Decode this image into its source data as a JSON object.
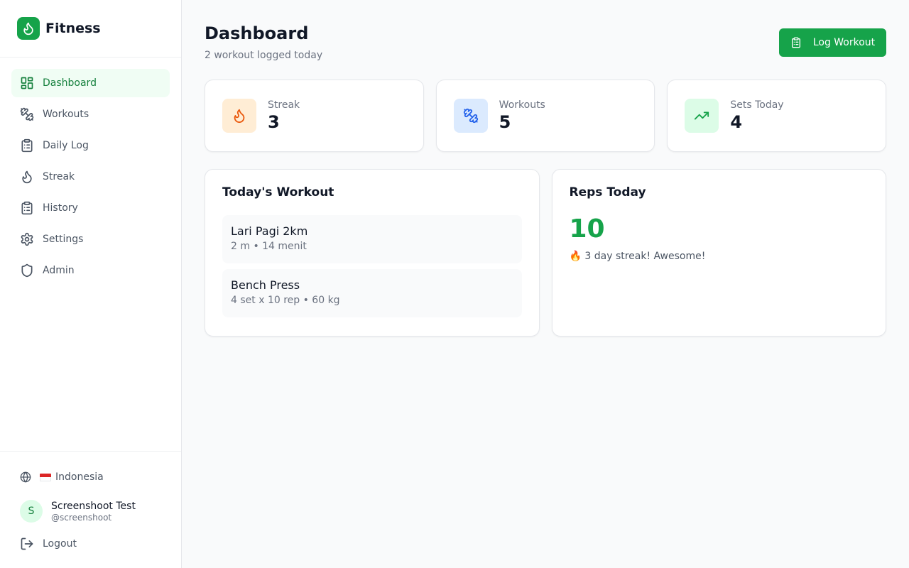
{
  "brand": {
    "name": "Fitness"
  },
  "nav": {
    "items": [
      {
        "label": "Dashboard",
        "icon": "dashboard-icon",
        "active": true
      },
      {
        "label": "Workouts",
        "icon": "dumbbell-icon"
      },
      {
        "label": "Daily Log",
        "icon": "clipboard-icon"
      },
      {
        "label": "Streak",
        "icon": "flame-icon"
      },
      {
        "label": "History",
        "icon": "clipboard-list-icon"
      },
      {
        "label": "Settings",
        "icon": "gear-icon"
      },
      {
        "label": "Admin",
        "icon": "shield-icon"
      }
    ]
  },
  "footer": {
    "language": "Indonesia",
    "user": {
      "initial": "S",
      "name": "Screenshoot Test",
      "handle": "@screenshoot"
    },
    "logout": "Logout"
  },
  "header": {
    "title": "Dashboard",
    "subtitle": "2 workout logged today",
    "log_button": "Log Workout"
  },
  "stats": [
    {
      "label": "Streak",
      "value": "3",
      "icon": "flame-icon",
      "color": "#ea580c",
      "bg": "#ffedd5"
    },
    {
      "label": "Workouts",
      "value": "5",
      "icon": "dumbbell-icon",
      "color": "#2563eb",
      "bg": "#dbeafe"
    },
    {
      "label": "Sets Today",
      "value": "4",
      "icon": "trending-up-icon",
      "color": "#16a34a",
      "bg": "#dcfce7"
    }
  ],
  "todays_workout": {
    "title": "Today's Workout",
    "items": [
      {
        "name": "Lari Pagi 2km",
        "detail": "2 m • 14 menit"
      },
      {
        "name": "Bench Press",
        "detail": "4 set x 10 rep • 60 kg"
      }
    ]
  },
  "reps_today": {
    "title": "Reps Today",
    "value": "10",
    "note": "🔥 3 day streak! Awesome!"
  },
  "colors": {
    "accent": "#16a34a",
    "accent_light": "#f0fdf4"
  }
}
